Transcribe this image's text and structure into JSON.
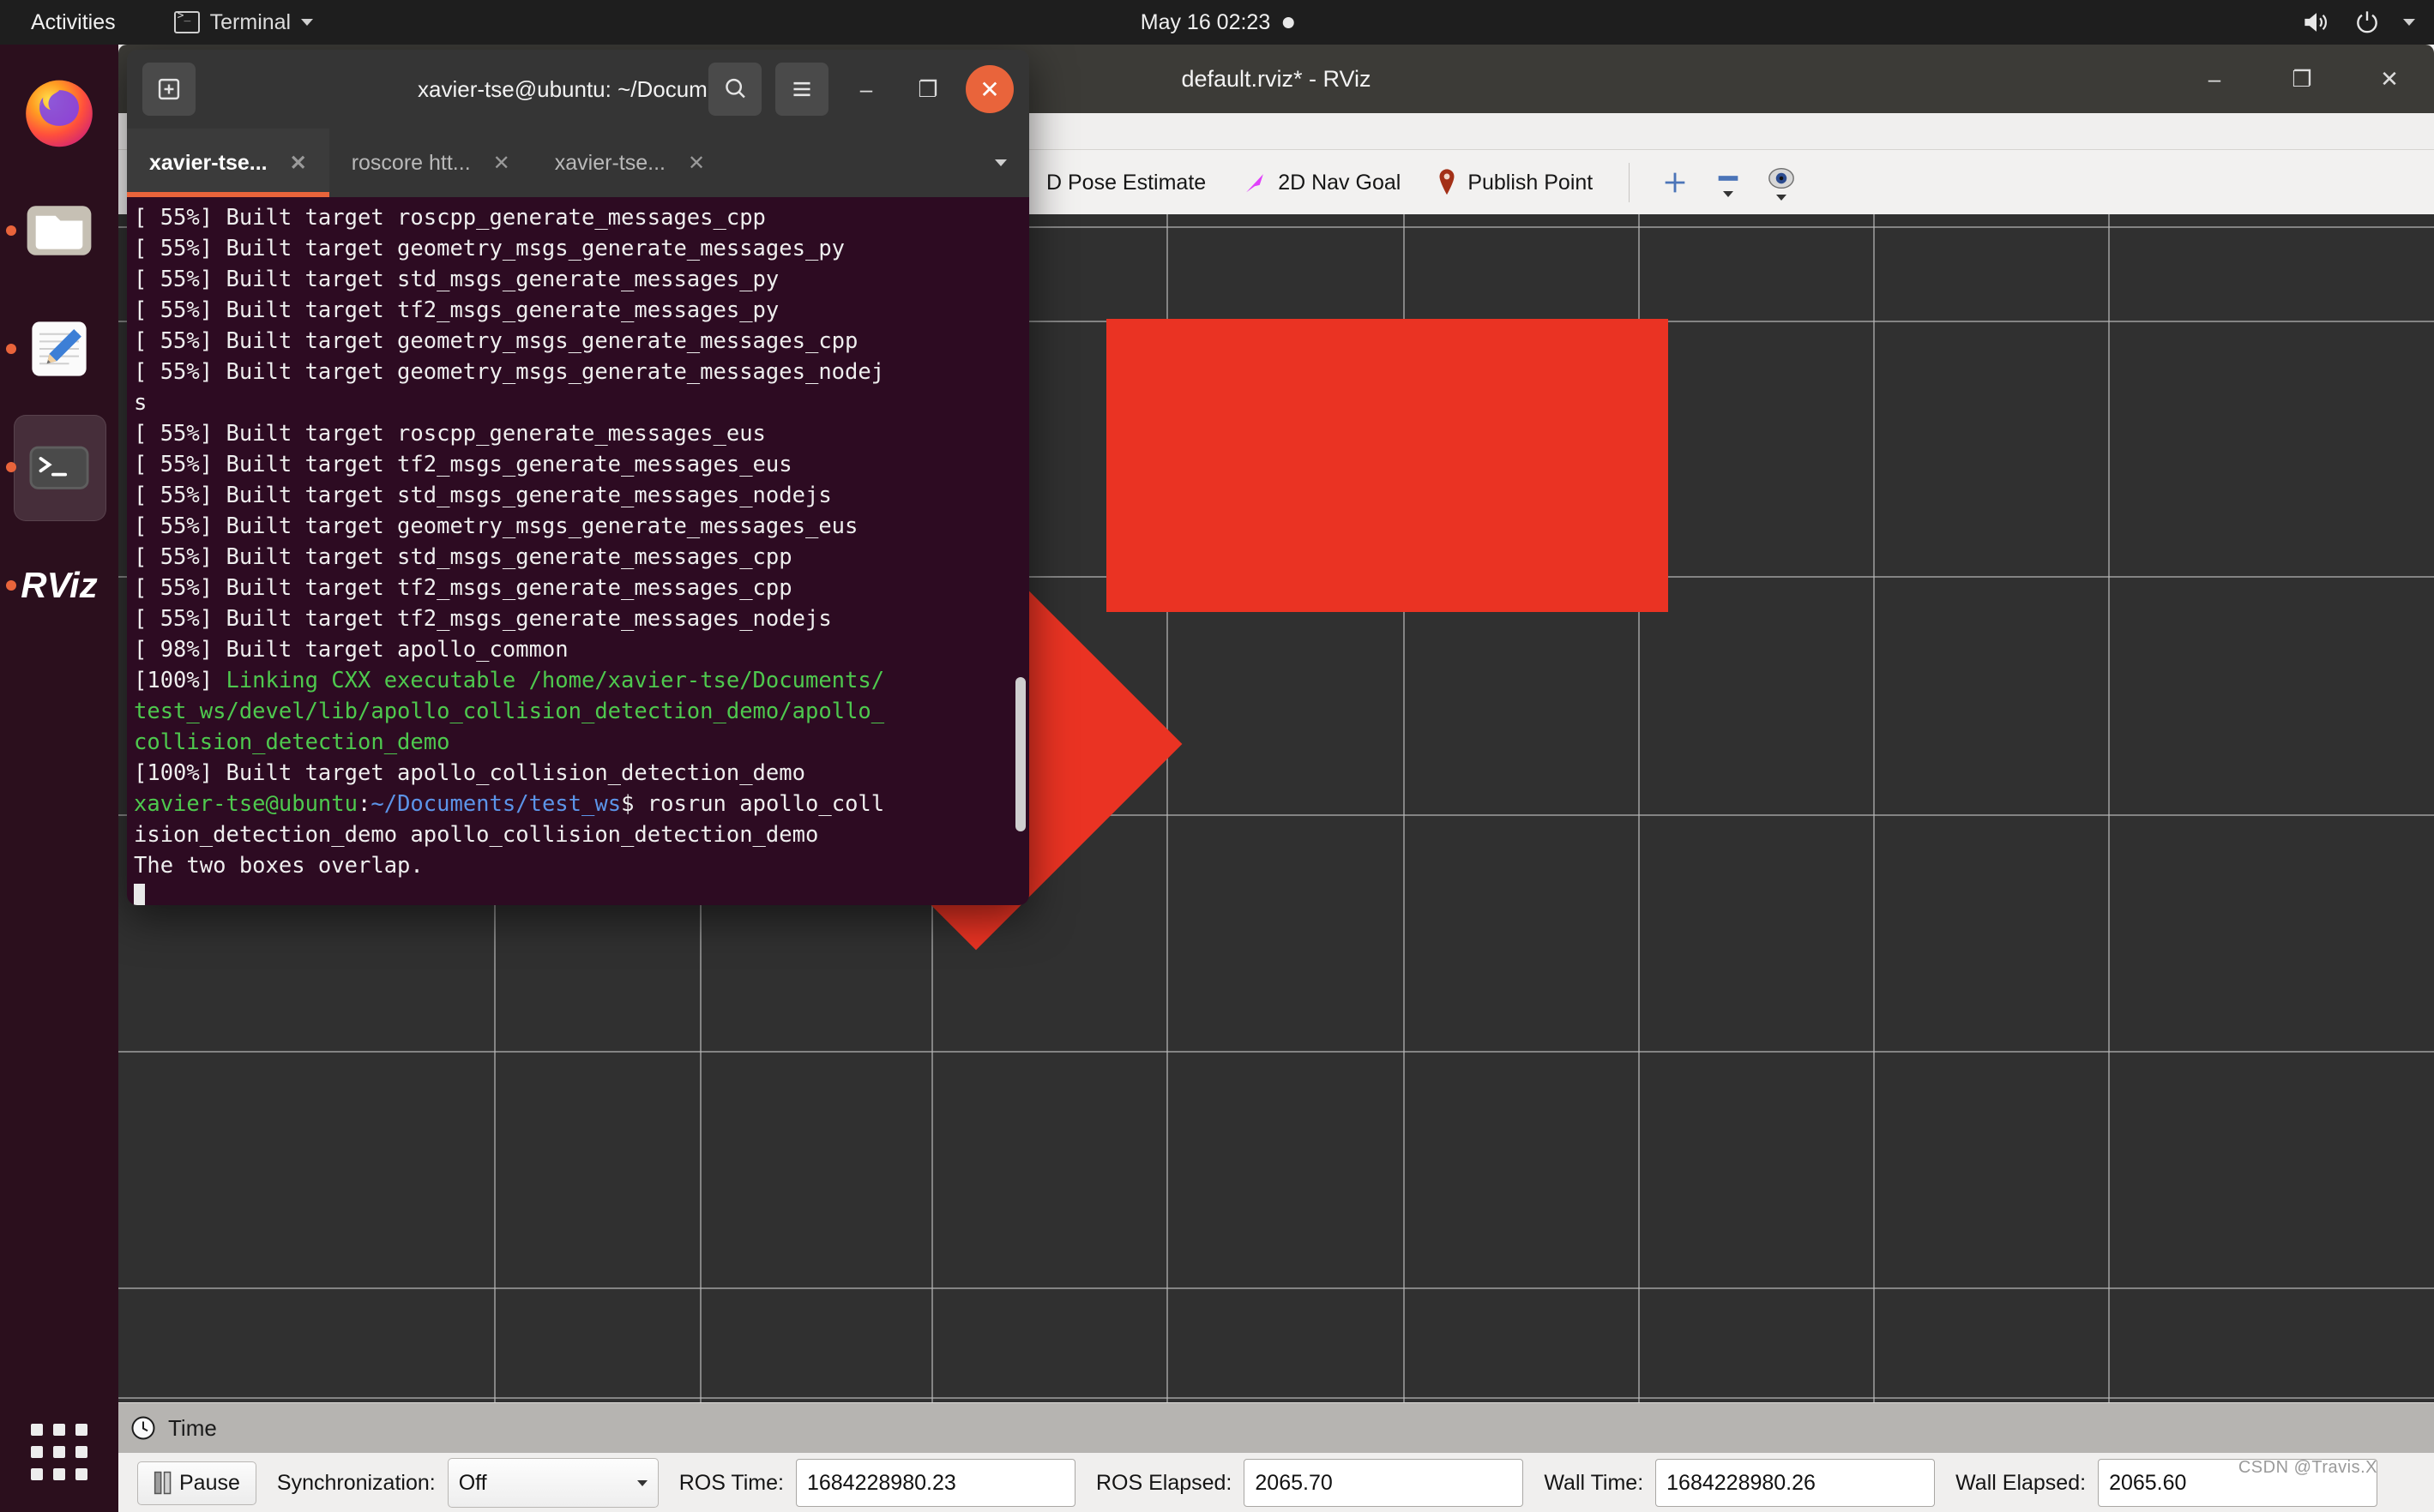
{
  "topbar": {
    "activities": "Activities",
    "app_name": "Terminal",
    "app_icon": "terminal-icon",
    "clock": "May 16  02:23",
    "recording_indicator": "record-dot",
    "volume_icon": "volume-icon",
    "power_icon": "power-icon",
    "menu_arrow_icon": "chevron-down-icon"
  },
  "dock": {
    "items": [
      {
        "name": "firefox",
        "label": "Firefox",
        "running": false,
        "active": false
      },
      {
        "name": "files",
        "label": "Files",
        "running": true,
        "active": false
      },
      {
        "name": "text-editor",
        "label": "Text Editor",
        "running": true,
        "active": false
      },
      {
        "name": "terminal",
        "label": "Terminal",
        "running": true,
        "active": true
      },
      {
        "name": "rviz",
        "label": "RViz",
        "running": true,
        "active": false
      }
    ],
    "app_grid_label": "Show Applications"
  },
  "terminal": {
    "title": "xavier-tse@ubuntu: ~/Docume...",
    "new_tab_icon": "new-tab-icon",
    "search_icon": "search-icon",
    "menu_icon": "hamburger-menu-icon",
    "minimize_label": "–",
    "maximize_label": "❐",
    "close_label": "✕",
    "tabs": [
      {
        "label": "xavier-tse...",
        "active": true
      },
      {
        "label": "roscore htt...",
        "active": false
      },
      {
        "label": "xavier-tse...",
        "active": false
      }
    ],
    "tab_list_icon": "chevron-down-icon",
    "lines": [
      "[ 55%] Built target roscpp_generate_messages_cpp",
      "[ 55%] Built target geometry_msgs_generate_messages_py",
      "[ 55%] Built target std_msgs_generate_messages_py",
      "[ 55%] Built target tf2_msgs_generate_messages_py",
      "[ 55%] Built target geometry_msgs_generate_messages_cpp",
      "[ 55%] Built target geometry_msgs_generate_messages_nodej",
      "s",
      "[ 55%] Built target roscpp_generate_messages_eus",
      "[ 55%] Built target tf2_msgs_generate_messages_eus",
      "[ 55%] Built target std_msgs_generate_messages_nodejs",
      "[ 55%] Built target geometry_msgs_generate_messages_eus",
      "[ 55%] Built target std_msgs_generate_messages_cpp",
      "[ 55%] Built target tf2_msgs_generate_messages_cpp",
      "[ 55%] Built target tf2_msgs_generate_messages_nodejs",
      "[ 98%] Built target apollo_common"
    ],
    "link_line_prefix": "[100%] ",
    "link_line_green": "Linking CXX executable /home/xavier-tse/Documents/",
    "link_line_green2": "test_ws/devel/lib/apollo_collision_detection_demo/apollo_",
    "link_line_green3": "collision_detection_demo",
    "built_line": "[100%] Built target apollo_collision_detection_demo",
    "prompt_user": "xavier-tse@ubuntu",
    "prompt_colon": ":",
    "prompt_path": "~/Documents/test_ws",
    "prompt_dollar": "$ ",
    "command_part1": "rosrun apollo_coll",
    "command_part2": "ision_detection_demo apollo_collision_detection_demo",
    "output_line": "The two boxes overlap."
  },
  "rviz": {
    "title": "default.rviz* - RViz",
    "window_buttons": {
      "minimize": "–",
      "maximize": "❐",
      "close": "✕"
    },
    "toolbar": [
      {
        "name": "2d-pose-estimate-tool",
        "label": "D Pose Estimate",
        "icon": "pose-arrow-icon"
      },
      {
        "name": "2d-nav-goal-tool",
        "label": "2D Nav Goal",
        "icon": "nav-goal-arrow-icon"
      },
      {
        "name": "publish-point-tool",
        "label": "Publish Point",
        "icon": "map-pin-icon"
      }
    ],
    "mini_tools": [
      {
        "name": "add-tool-button",
        "icon": "plus-icon"
      },
      {
        "name": "remove-tool-button",
        "icon": "minus-icon"
      },
      {
        "name": "focus-camera-button",
        "icon": "eye-icon"
      }
    ],
    "time_panel": {
      "header": "Time",
      "clock_icon": "clock-icon",
      "pause_label": "Pause",
      "pause_icon": "pause-icon",
      "sync_label": "Synchronization:",
      "sync_value": "Off",
      "ros_time_label": "ROS Time:",
      "ros_time_value": "1684228980.23",
      "ros_elapsed_label": "ROS Elapsed:",
      "ros_elapsed_value": "2065.70",
      "wall_time_label": "Wall Time:",
      "wall_time_value": "1684228980.26",
      "wall_elapsed_label": "Wall Elapsed:",
      "wall_elapsed_value": "2065.60"
    },
    "watermark": "CSDN @Travis.X",
    "viewport": {
      "background_color": "#303030",
      "grid_color": "#b8b8b8",
      "shape_color": "#ea3323",
      "shapes": [
        {
          "name": "box-rectangle",
          "note": "axis-aligned red rectangle (upper box)"
        },
        {
          "name": "box-diamond",
          "note": "rotated red square 45 degrees (lower box)"
        }
      ]
    }
  }
}
